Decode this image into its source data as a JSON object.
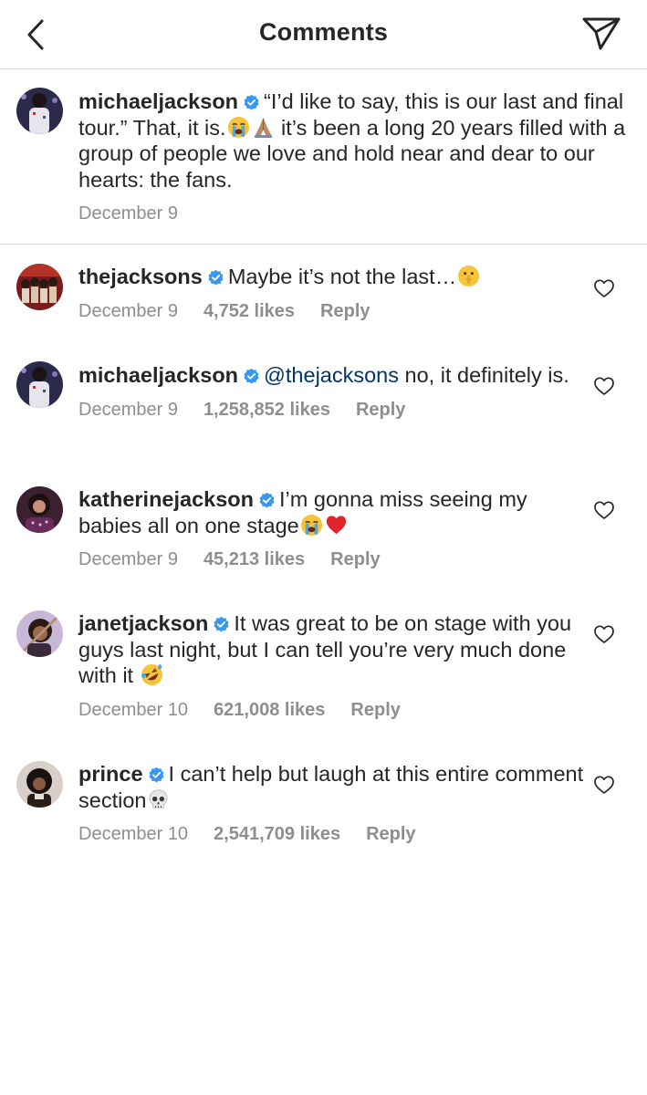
{
  "header": {
    "back_icon": "chevron-left-icon",
    "title": "Comments",
    "share_icon": "paper-plane-icon"
  },
  "caption": {
    "username": "michaeljackson",
    "text_1": "“I’d like to say, this is our last and final tour.” That, it is.",
    "text_2": " it’s been a long 20 years filled with a group of people we love and hold near and dear to our hearts: the fans.",
    "date": "December 9",
    "emojis": [
      "loudly-crying-face",
      "folded-hands"
    ]
  },
  "comments": [
    {
      "username": "thejacksons",
      "text": "Maybe it’s not the last…",
      "emoji": "shushing-face",
      "date": "December 9",
      "likes": "4,752 likes",
      "reply": "Reply"
    },
    {
      "username": "michaeljackson",
      "mention": "@thejacksons",
      "text": " no, it definitely is.",
      "date": "December 9",
      "likes": "1,258,852 likes",
      "reply": "Reply"
    },
    {
      "username": "katherinejackson",
      "text": "I’m gonna miss seeing my babies all on one stage",
      "emojis": [
        "loudly-crying-face",
        "red-heart"
      ],
      "date": "December 9",
      "likes": "45,213 likes",
      "reply": "Reply"
    },
    {
      "username": "janetjackson",
      "text": "It was great to be on stage with you guys last night, but I can tell you’re very much done with it ",
      "emoji": "rolling-on-floor-laughing",
      "date": "December 10",
      "likes": "621,008 likes",
      "reply": "Reply"
    },
    {
      "username": "prince",
      "text": "I can’t help but laugh at this entire comment section",
      "emoji": "skull",
      "date": "December 10",
      "likes": "2,541,709 likes",
      "reply": "Reply"
    }
  ],
  "colors": {
    "verified": "#3897f0",
    "meta_gray": "#8e8e8e",
    "mention": "#003569",
    "divider": "#dbdbdb"
  }
}
